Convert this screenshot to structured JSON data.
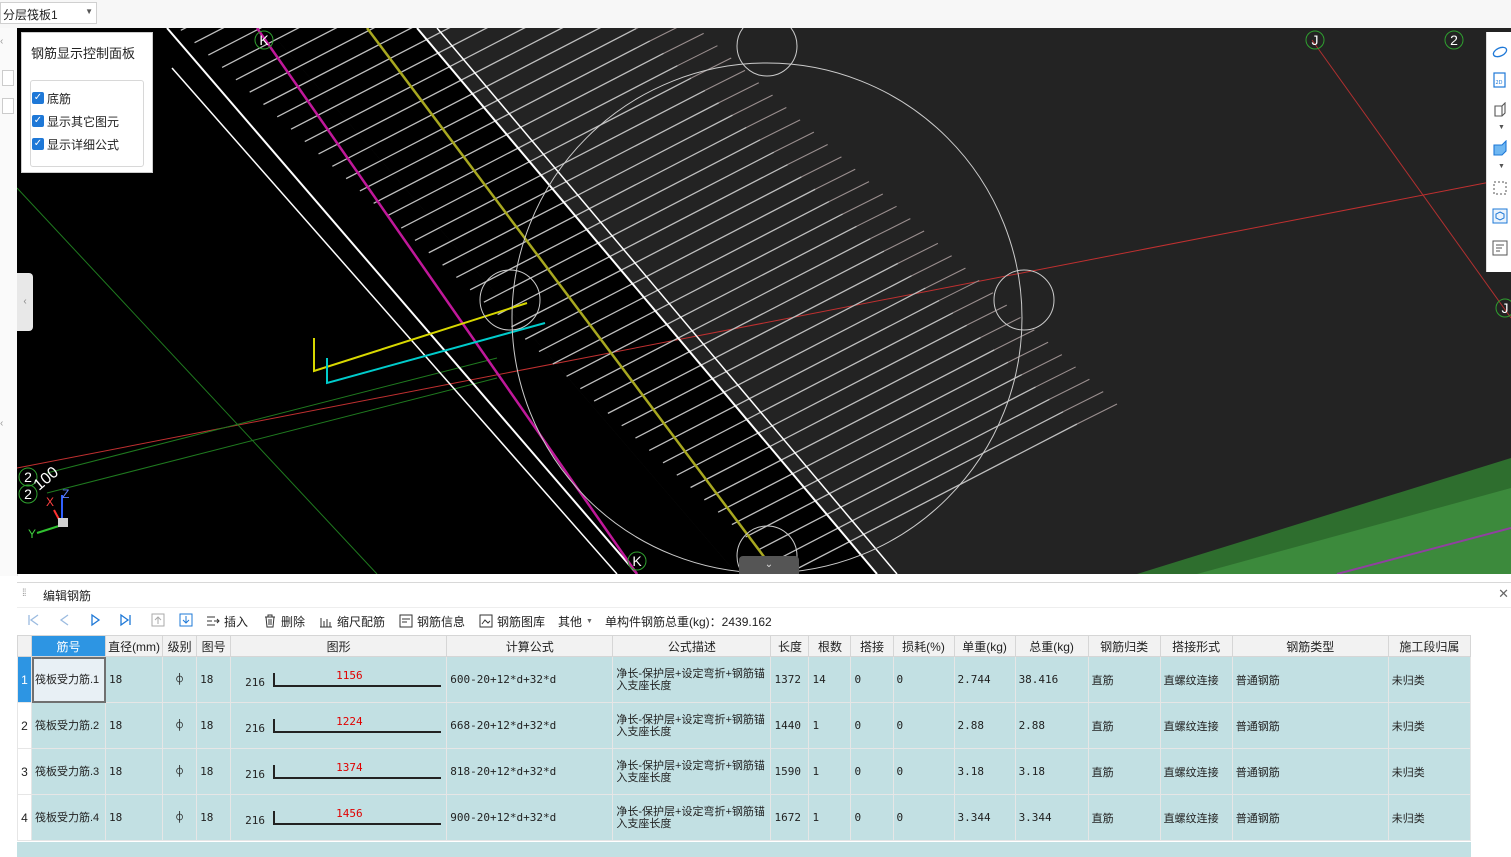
{
  "top": {
    "layer_select": "分层筏板1"
  },
  "viewport": {
    "axis_labels": {
      "k_top": "K",
      "k_bottom": "K",
      "j_top": "J",
      "j_right": "J",
      "two_top": "2",
      "two_left_a": "2",
      "two_left_b": "2",
      "hundred": "100"
    },
    "triad": {
      "x": "X",
      "y": "Y",
      "z": "Z"
    }
  },
  "control_panel": {
    "title": "钢筋显示控制面板",
    "options": [
      {
        "label": "底筋",
        "checked": true
      },
      {
        "label": "显示其它图元",
        "checked": true
      },
      {
        "label": "显示详细公式",
        "checked": true
      }
    ]
  },
  "editor": {
    "title": "编辑钢筋",
    "toolbar": {
      "insert": "插入",
      "delete": "删除",
      "scale_rebar": "缩尺配筋",
      "rebar_info": "钢筋信息",
      "rebar_library": "钢筋图库",
      "other": "其他",
      "total_weight": "单构件钢筋总重(kg)：2439.162"
    },
    "columns": [
      "筋号",
      "直径(mm)",
      "级别",
      "图号",
      "图形",
      "计算公式",
      "公式描述",
      "长度",
      "根数",
      "搭接",
      "损耗(%)",
      "单重(kg)",
      "总重(kg)",
      "钢筋归类",
      "搭接形式",
      "钢筋类型",
      "施工段归属"
    ],
    "rows": [
      {
        "num": "1",
        "name": "筏板受力筋.1",
        "dia": "18",
        "grade": "⌽",
        "fig": "18",
        "shape_left": "216",
        "shape_len": "1156",
        "formula": "600-20+12*d+32*d",
        "desc": "净长-保护层+设定弯折+钢筋锚入支座长度",
        "length": "1372",
        "count": "14",
        "lap": "0",
        "loss": "0",
        "unit_w": "2.744",
        "total_w": "38.416",
        "category": "直筋",
        "lap_type": "直螺纹连接",
        "bar_type": "普通钢筋",
        "segment": "未归类"
      },
      {
        "num": "2",
        "name": "筏板受力筋.2",
        "dia": "18",
        "grade": "⌽",
        "fig": "18",
        "shape_left": "216",
        "shape_len": "1224",
        "formula": "668-20+12*d+32*d",
        "desc": "净长-保护层+设定弯折+钢筋锚入支座长度",
        "length": "1440",
        "count": "1",
        "lap": "0",
        "loss": "0",
        "unit_w": "2.88",
        "total_w": "2.88",
        "category": "直筋",
        "lap_type": "直螺纹连接",
        "bar_type": "普通钢筋",
        "segment": "未归类"
      },
      {
        "num": "3",
        "name": "筏板受力筋.3",
        "dia": "18",
        "grade": "⌽",
        "fig": "18",
        "shape_left": "216",
        "shape_len": "1374",
        "formula": "818-20+12*d+32*d",
        "desc": "净长-保护层+设定弯折+钢筋锚入支座长度",
        "length": "1590",
        "count": "1",
        "lap": "0",
        "loss": "0",
        "unit_w": "3.18",
        "total_w": "3.18",
        "category": "直筋",
        "lap_type": "直螺纹连接",
        "bar_type": "普通钢筋",
        "segment": "未归类"
      },
      {
        "num": "4",
        "name": "筏板受力筋.4",
        "dia": "18",
        "grade": "⌽",
        "fig": "18",
        "shape_left": "216",
        "shape_len": "1456",
        "formula": "900-20+12*d+32*d",
        "desc": "净长-保护层+设定弯折+钢筋锚入支座长度",
        "length": "1672",
        "count": "1",
        "lap": "0",
        "loss": "0",
        "unit_w": "3.344",
        "total_w": "3.344",
        "category": "直筋",
        "lap_type": "直螺纹连接",
        "bar_type": "普通钢筋",
        "segment": "未归类"
      }
    ]
  }
}
